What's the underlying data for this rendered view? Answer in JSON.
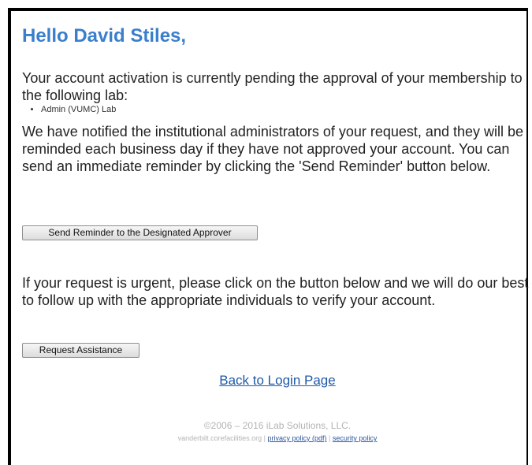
{
  "greeting": "Hello David Stiles,",
  "pending_text": "Your account activation is currently pending the approval of your membership to the following lab:",
  "labs": [
    "Admin (VUMC) Lab"
  ],
  "notified_text": "We have notified the institutional administrators of your request, and they will be reminded each business day if they have not approved your account. You can send an immediate reminder by clicking the 'Send Reminder' button below.",
  "reminder_button": "Send Reminder to the Designated Approver",
  "urgent_text": "If your request is urgent, please click on the button below and we will do our best to follow up with the appropriate individuals to verify your account.",
  "assistance_button": "Request Assistance",
  "login_link": "Back to Login Page",
  "footer": {
    "copyright": "©2006 – 2016 iLab Solutions, LLC.",
    "site": "vanderbilt.corefacilities.org",
    "separator": "|",
    "privacy_link": "privacy policy (pdf)",
    "security_link": "security policy"
  },
  "colors": {
    "heading": "#3a7fcc",
    "link": "#1f5aa8",
    "footer_text": "#b4b4b4"
  }
}
